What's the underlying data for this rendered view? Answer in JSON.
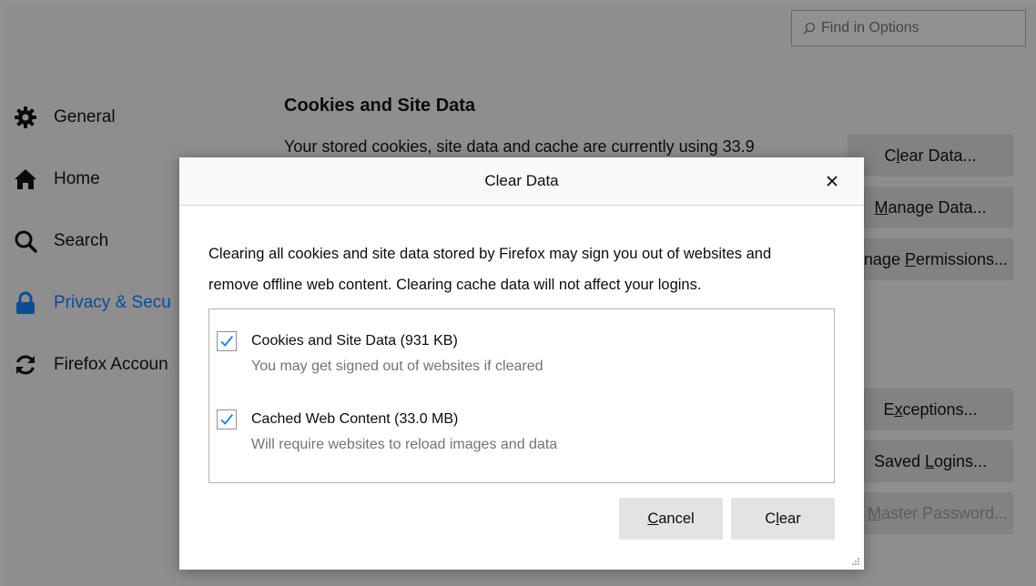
{
  "search": {
    "placeholder": "Find in Options"
  },
  "nav": {
    "items": [
      {
        "label": "General",
        "icon": "gear-icon"
      },
      {
        "label": "Home",
        "icon": "home-icon"
      },
      {
        "label": "Search",
        "icon": "search-icon"
      },
      {
        "label": "Privacy & Secu",
        "icon": "lock-icon",
        "selected": true
      },
      {
        "label": "Firefox Accoun",
        "icon": "sync-icon"
      }
    ]
  },
  "section": {
    "title": "Cookies and Site Data",
    "description": "Your stored cookies, site data and cache are currently using 33.9"
  },
  "side_buttons": {
    "clear_data": {
      "pre": "C",
      "key": "l",
      "post": "ear Data..."
    },
    "manage_data": {
      "pre": "",
      "key": "M",
      "post": "anage Data..."
    },
    "manage_permissions": {
      "pre": "nage ",
      "key": "P",
      "post": "ermissions..."
    },
    "exceptions": {
      "pre": "E",
      "key": "x",
      "post": "ceptions..."
    },
    "saved_logins": {
      "pre": "Saved ",
      "key": "L",
      "post": "ogins..."
    },
    "master_password": {
      "pre": "e ",
      "key": "M",
      "post": "aster Password..."
    }
  },
  "dialog": {
    "title": "Clear Data",
    "close_icon": "close-icon",
    "text_line1": "Clearing all cookies and site data stored by Firefox may sign you out of websites and",
    "text_line2": "remove offline web content. Clearing cache data will not affect your logins.",
    "options": [
      {
        "label": "Cookies and Site Data (931 KB)",
        "hint": "You may get signed out of websites if cleared",
        "checked": true
      },
      {
        "label": "Cached Web Content (33.0 MB)",
        "hint": "Will require websites to reload images and data",
        "checked": true
      }
    ],
    "cancel": {
      "pre": "",
      "key": "C",
      "post": "ancel"
    },
    "clear": {
      "pre": "C",
      "key": "l",
      "post": "ear"
    }
  },
  "colors": {
    "accent": "#0a84ff",
    "overlay": "#0c0c0d",
    "button_bg": "#e3e3e6"
  }
}
